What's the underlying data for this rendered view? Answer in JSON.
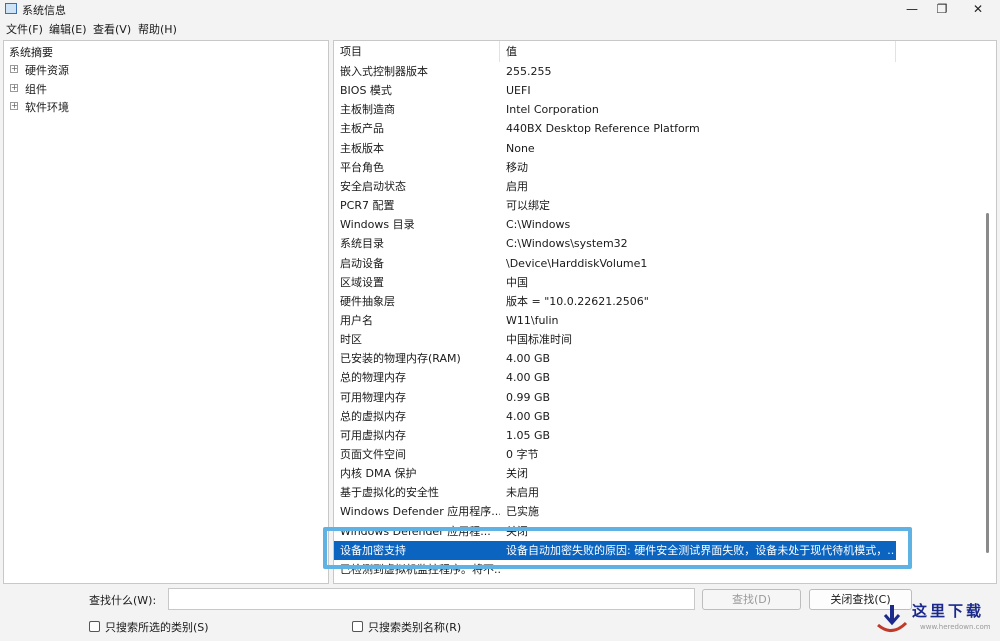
{
  "window": {
    "title": "系统信息",
    "controls": [
      "—",
      "❐",
      "✕"
    ]
  },
  "menu": [
    "文件(F)",
    "编辑(E)",
    "查看(V)",
    "帮助(H)"
  ],
  "tree": {
    "root": "系统摘要",
    "children": [
      {
        "expander": "+",
        "label": "硬件资源"
      },
      {
        "expander": "+",
        "label": "组件"
      },
      {
        "expander": "+",
        "label": "软件环境"
      }
    ]
  },
  "table": {
    "headers": [
      "项目",
      "值"
    ],
    "rows": [
      {
        "key": "嵌入式控制器版本",
        "value": "255.255"
      },
      {
        "key": "BIOS 模式",
        "value": "UEFI"
      },
      {
        "key": "主板制造商",
        "value": "Intel Corporation"
      },
      {
        "key": "主板产品",
        "value": "440BX Desktop Reference Platform"
      },
      {
        "key": "主板版本",
        "value": "None"
      },
      {
        "key": "平台角色",
        "value": "移动"
      },
      {
        "key": "安全启动状态",
        "value": "启用"
      },
      {
        "key": "PCR7 配置",
        "value": "可以绑定"
      },
      {
        "key": "Windows 目录",
        "value": "C:\\Windows"
      },
      {
        "key": "系统目录",
        "value": "C:\\Windows\\system32"
      },
      {
        "key": "启动设备",
        "value": "\\Device\\HarddiskVolume1"
      },
      {
        "key": "区域设置",
        "value": "中国"
      },
      {
        "key": "硬件抽象层",
        "value": "版本 = \"10.0.22621.2506\""
      },
      {
        "key": "用户名",
        "value": "W11\\fulin"
      },
      {
        "key": "时区",
        "value": "中国标准时间"
      },
      {
        "key": "已安装的物理内存(RAM)",
        "value": "4.00 GB"
      },
      {
        "key": "总的物理内存",
        "value": "4.00 GB"
      },
      {
        "key": "可用物理内存",
        "value": "0.99 GB"
      },
      {
        "key": "总的虚拟内存",
        "value": "4.00 GB"
      },
      {
        "key": "可用虚拟内存",
        "value": "1.05 GB"
      },
      {
        "key": "页面文件空间",
        "value": "0 字节"
      },
      {
        "key": "内核 DMA 保护",
        "value": "关闭"
      },
      {
        "key": "基于虚拟化的安全性",
        "value": "未启用"
      },
      {
        "key": "Windows Defender 应用程序...",
        "value": "已实施"
      },
      {
        "key": "Windows Defender 应用程...",
        "value": "关闭"
      },
      {
        "key": "设备加密支持",
        "value": "设备自动加密失败的原因: 硬件安全测试界面失败，设备未处于现代待机模式，...",
        "selected": true
      },
      {
        "key": "已检测到虚拟机监控程序。将不...",
        "value": ""
      }
    ]
  },
  "find": {
    "label": "查找什么(W):",
    "value": "",
    "find_button": "查找(D)",
    "close_button": "关闭查找(C)",
    "checkbox_selected_category": "只搜索所选的类别(S)",
    "checkbox_category_names": "只搜索类别名称(R)"
  },
  "watermark": {
    "text": "这里下载",
    "url": "www.heredown.com"
  },
  "colors": {
    "selection": "#0b64c0",
    "highlight_frame": "#5fb3e4",
    "watermark_text": "#1b2a8a"
  }
}
